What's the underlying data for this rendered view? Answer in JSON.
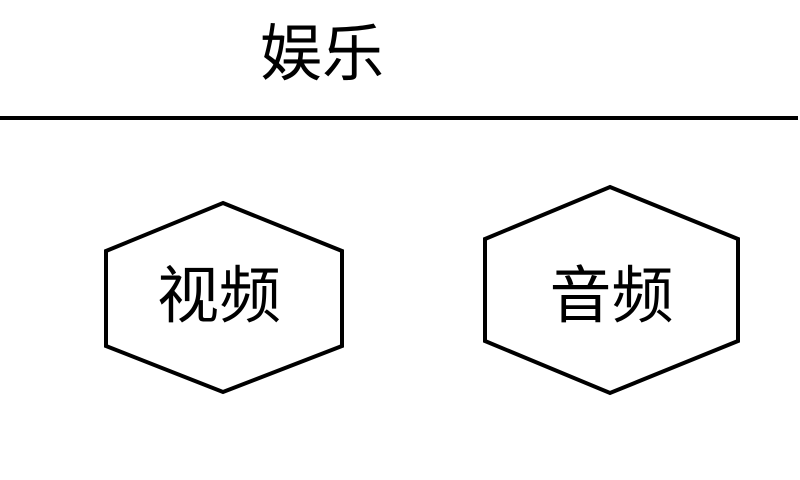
{
  "header": {
    "title": "娱乐"
  },
  "menu": {
    "items": [
      {
        "id": "video",
        "label": "视频"
      },
      {
        "id": "audio",
        "label": "音频"
      }
    ]
  },
  "colors": {
    "background": "#ffffff",
    "foreground": "#000000"
  }
}
